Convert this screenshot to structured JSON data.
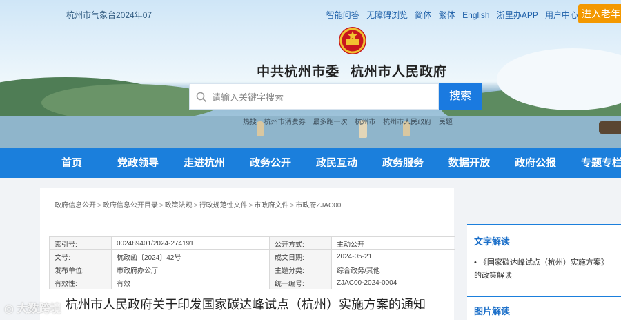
{
  "header": {
    "weather_text": "杭州市气象台2024年07",
    "top_links": [
      "智能问答",
      "无障碍浏览",
      "简体",
      "繁体",
      "English",
      "浙里办APP",
      "用户中心"
    ],
    "elder_mode_label": "进入老年",
    "site_title_party": "中共杭州市委",
    "site_title_gov": "杭州市人民政府",
    "emblem_icon": "national-emblem-icon"
  },
  "search": {
    "placeholder": "请输入关键字搜索",
    "button_label": "搜索",
    "hot_words": [
      "热搜",
      "杭州市消费券",
      "最多跑一次",
      "杭州市",
      "杭州市人民政府",
      "民题"
    ]
  },
  "nav": {
    "items": [
      "首页",
      "党政领导",
      "走进杭州",
      "政务公开",
      "政民互动",
      "政务服务",
      "数据开放",
      "政府公报",
      "专题专栏"
    ]
  },
  "breadcrumb": [
    "政府信息公开",
    "政府信息公开目录",
    "政策法规",
    "行政规范性文件",
    "市政府文件",
    "市政府ZJAC00"
  ],
  "meta_table": {
    "rows": [
      {
        "k1": "索引号:",
        "v1": "002489401/2024-274191",
        "k2": "公开方式:",
        "v2": "主动公开"
      },
      {
        "k1": "文号:",
        "v1": "杭政函〔2024〕42号",
        "k2": "成文日期:",
        "v2": "2024-05-21"
      },
      {
        "k1": "发布单位:",
        "v1": "市政府办公厅",
        "k2": "主题分类:",
        "v2": "综合政务/其他"
      },
      {
        "k1": "有效性:",
        "v1": "有效",
        "k2": "统一编号:",
        "v2": "ZJAC00-2024-0004"
      }
    ]
  },
  "document": {
    "title": "杭州市人民政府关于印发国家碳达峰试点（杭州）实施方案的通知"
  },
  "sidebar": {
    "text_interpretation_title": "文字解读",
    "text_interpretation_item": "《国家碳达峰试点（杭州）实施方案》的政策解读",
    "image_interpretation_title": "图片解读"
  },
  "watermark": {
    "text": "大数跨境"
  },
  "colors": {
    "nav_blue": "#1b7fdc",
    "search_button": "#1a7ae0",
    "elder_button": "#f39800",
    "link_blue": "#1d5fa8"
  }
}
